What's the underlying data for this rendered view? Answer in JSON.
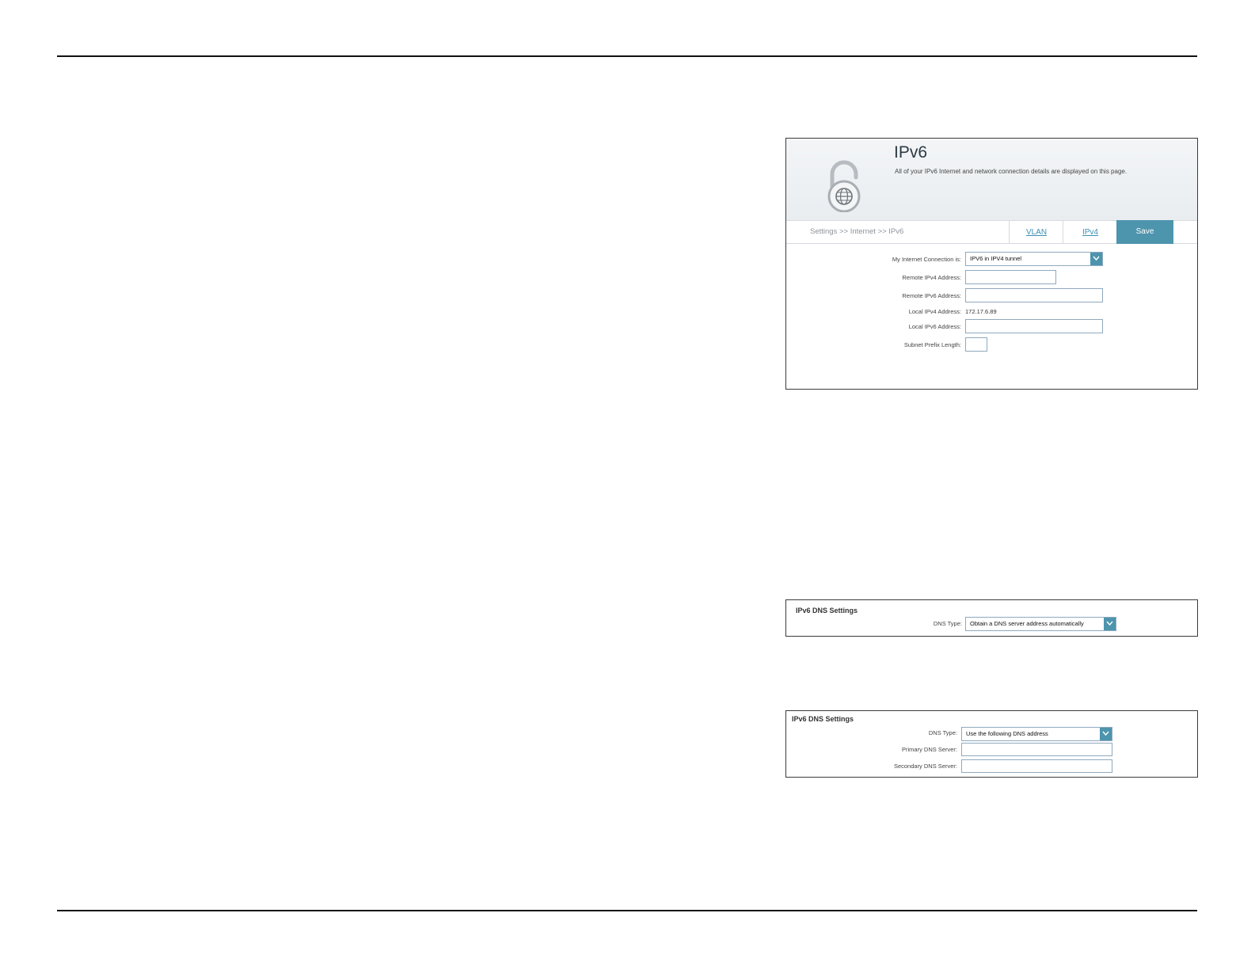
{
  "panel_ipv6": {
    "title": "IPv6",
    "subtitle": "All of your IPv6 Internet and network connection details are displayed on this page.",
    "breadcrumb": "Settings >> Internet >> IPv6",
    "tabs": {
      "vlan": "VLAN",
      "ipv4": "IPv4"
    },
    "save_label": "Save",
    "icon": "lock-globe-icon",
    "fields": {
      "connection_label": "My Internet Connection is:",
      "connection_value": "IPV6 in IPV4 tunnel",
      "remote_ipv4_label": "Remote IPv4 Address:",
      "remote_ipv6_label": "Remote IPv6 Address:",
      "local_ipv4_label": "Local IPv4 Address:",
      "local_ipv4_value": "172.17.6.89",
      "local_ipv6_label": "Local IPv6 Address:",
      "prefix_label": "Subnet Prefix Length:"
    }
  },
  "panel_dns_auto": {
    "title": "IPv6 DNS Settings",
    "dns_type_label": "DNS Type:",
    "dns_type_value": "Obtain a DNS server address automatically"
  },
  "panel_dns_manual": {
    "title": "IPv6 DNS Settings",
    "dns_type_label": "DNS Type:",
    "dns_type_value": "Use the following DNS address",
    "primary_label": "Primary DNS Server:",
    "secondary_label": "Secondary DNS Server:"
  },
  "colors": {
    "accent": "#4d94ad",
    "link": "#3d8fb5",
    "input_border": "#8fa9bf"
  }
}
